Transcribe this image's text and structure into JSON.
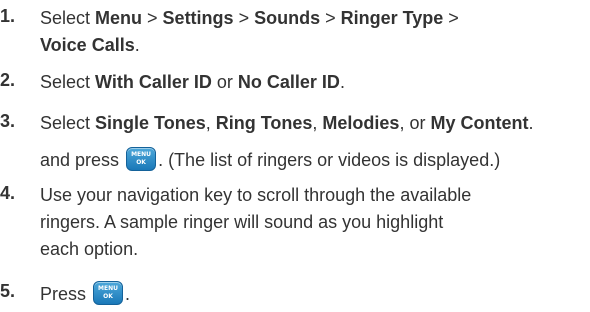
{
  "steps": [
    {
      "number": "1.",
      "lines": [
        [
          "Select ",
          "Menu",
          " > ",
          "Settings",
          " > ",
          "Sounds",
          " > ",
          "Ringer Type",
          " >"
        ],
        [
          "Voice Calls",
          "."
        ]
      ]
    },
    {
      "number": "2.",
      "lines": [
        [
          "Select ",
          "With Caller ID",
          " or ",
          "No Caller ID",
          "."
        ]
      ]
    },
    {
      "number": "3.",
      "lines": [
        [
          "Select ",
          "Single Tones",
          ", ",
          "Ring Tones",
          ", ",
          "Melodies",
          ", or ",
          "My Content",
          "."
        ],
        [
          "and press ",
          "",
          ". (The list of ringers or videos is displayed.)"
        ]
      ]
    },
    {
      "number": "4.",
      "lines": [
        [
          "Use your navigation key to scroll through the available"
        ],
        [
          "ringers. A sample ringer will sound as you highlight"
        ],
        [
          "each option."
        ]
      ]
    },
    {
      "number": "5.",
      "lines": [
        [
          "Press ",
          "",
          "."
        ]
      ]
    }
  ],
  "menu_ok_key": {
    "icon": "menu-ok-key-icon",
    "top_label": "MENU",
    "bottom_label": "OK",
    "color": "#1a78b8"
  }
}
